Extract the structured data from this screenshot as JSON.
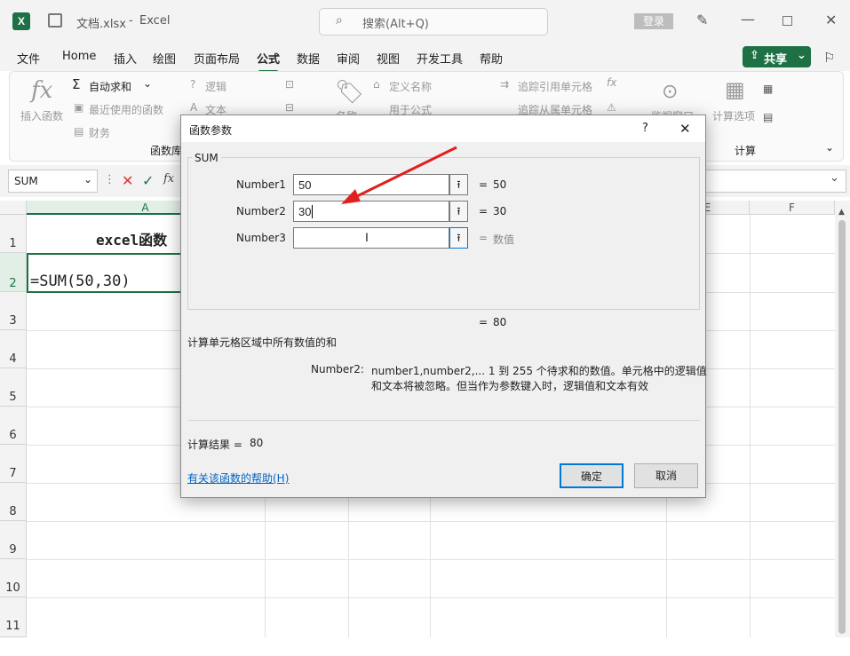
{
  "titlebar": {
    "filename": "文档.xlsx",
    "separator": "-",
    "app": "Excel",
    "search_placeholder": "搜索(Alt+Q)",
    "login": "登录"
  },
  "menu": {
    "items": [
      "文件",
      "Home",
      "插入",
      "绘图",
      "页面布局",
      "公式",
      "数据",
      "审阅",
      "视图",
      "开发工具",
      "帮助"
    ],
    "active": "公式",
    "share": "共享"
  },
  "ribbon": {
    "insert_function": "插入函数",
    "autosum": "自动求和",
    "recent": "最近使用的函数",
    "finance": "财务",
    "logic": "逻辑",
    "text": "文本",
    "group_library": "函数库",
    "define_name": "定义名称",
    "use_in_formula": "用于公式",
    "name_mgr": "名称",
    "trace_precedents": "追踪引用单元格",
    "trace_dependents": "追踪从属单元格",
    "watch": "监视窗口",
    "calc_options": "计算选项",
    "group_calc": "计算"
  },
  "formula_bar": {
    "name_box": "SUM",
    "fx": "fx"
  },
  "sheet": {
    "columns": [
      "A",
      "E",
      "F"
    ],
    "rows": [
      "1",
      "2",
      "3",
      "4",
      "5",
      "6",
      "7",
      "8",
      "9",
      "10",
      "11"
    ],
    "a1": "excel函数",
    "a2": "=SUM(50,30)"
  },
  "dialog": {
    "title": "函数参数",
    "help_q": "?",
    "close": "✕",
    "function_name": "SUM",
    "args": [
      {
        "label": "Number1",
        "value": "50",
        "result": "50"
      },
      {
        "label": "Number2",
        "value": "30",
        "result": "30"
      },
      {
        "label": "Number3",
        "value": "",
        "result": "数值"
      }
    ],
    "eq": "=",
    "total": "80",
    "description": "计算单元格区域中所有数值的和",
    "param_label": "Number2:",
    "param_desc_1": "number1,number2,... 1 到 255 个待求和的数值。单元格中的逻辑值",
    "param_desc_2": "和文本将被忽略。但当作为参数键入时，逻辑值和文本有效",
    "calc_result_label": "计算结果 =",
    "calc_result": "80",
    "help_link": "有关该函数的帮助(H)",
    "ok": "确定",
    "cancel": "取消"
  },
  "colors": {
    "accent": "#1e7145",
    "arrow": "#e02020",
    "link": "#0563c1"
  }
}
